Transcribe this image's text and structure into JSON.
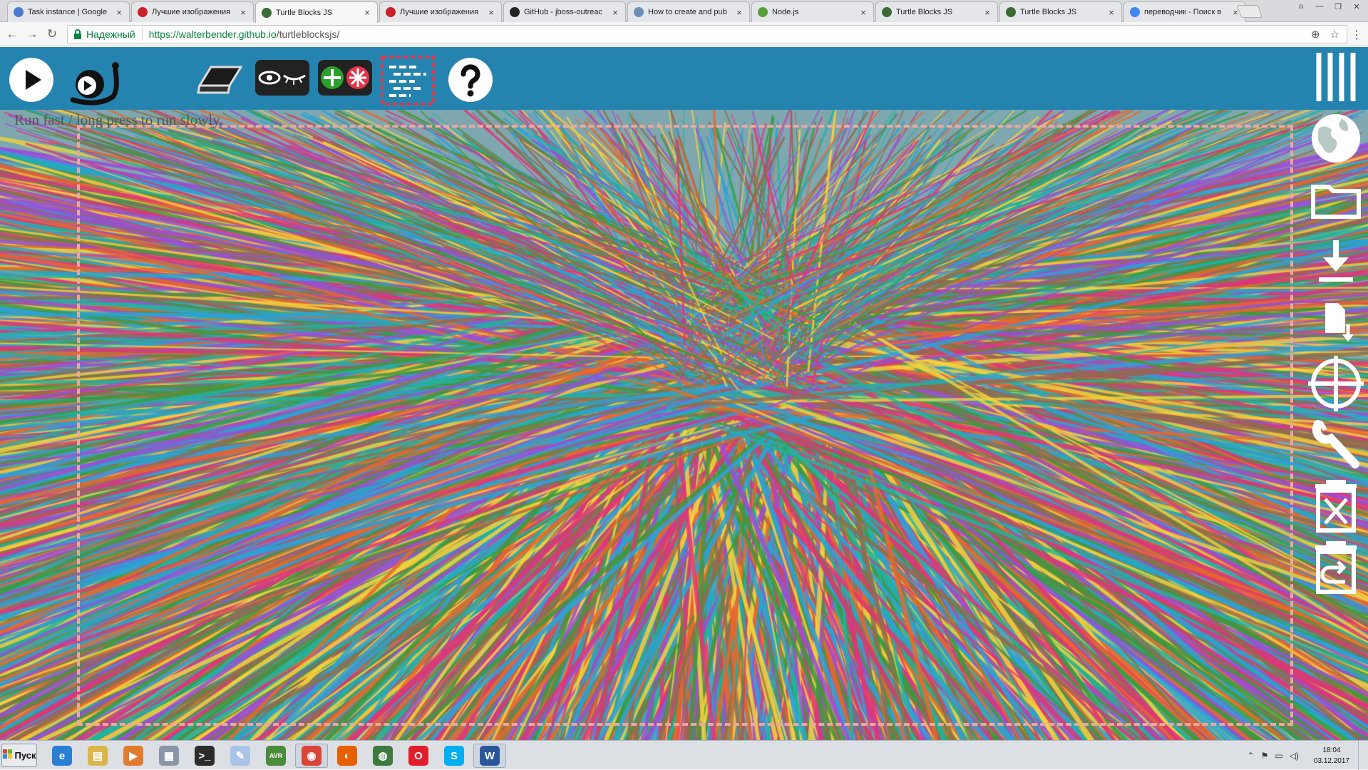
{
  "browser": {
    "tabs": [
      {
        "title": "Task instance | Google",
        "favicon": "gear-icon",
        "color": "#4a7bd0",
        "active": false
      },
      {
        "title": "Лучшие изображения",
        "favicon": "pinterest-icon",
        "color": "#cb2027",
        "active": false
      },
      {
        "title": "Turtle Blocks JS",
        "favicon": "turtle-icon",
        "color": "#3b6b34",
        "active": true
      },
      {
        "title": "Лучшие изображения",
        "favicon": "pinterest-icon",
        "color": "#cb2027",
        "active": false
      },
      {
        "title": "GitHub - jboss-outreac",
        "favicon": "github-icon",
        "color": "#222222",
        "active": false
      },
      {
        "title": "How to create and pub",
        "favicon": "eye-icon",
        "color": "#6a8fb5",
        "active": false
      },
      {
        "title": "Node.js",
        "favicon": "nodejs-icon",
        "color": "#5a9e3b",
        "active": false
      },
      {
        "title": "Turtle Blocks JS",
        "favicon": "turtle-icon",
        "color": "#3b6b34",
        "active": false
      },
      {
        "title": "Turtle Blocks JS",
        "favicon": "turtle-icon",
        "color": "#3b6b34",
        "active": false
      },
      {
        "title": "переводчик - Поиск в",
        "favicon": "google-icon",
        "color": "#4285f4",
        "active": false
      }
    ],
    "secure_label": "Надежный",
    "url_host": "https://walterbender.github.io",
    "url_path": "/turtleblocksjs/"
  },
  "app": {
    "hint": "Run fast / long press to run slowly.",
    "bar_color": "#2584af",
    "toolbar_icons": [
      "run-fast-icon",
      "run-slow-snail-icon",
      "clear-eraser-icon",
      "show-hide-blocks-icon",
      "expand-collapse-icon",
      "block-collapse-icon",
      "help-icon"
    ],
    "side_icons": [
      "menu-icon",
      "planet-icon",
      "open-folder-icon",
      "save-download-icon",
      "save-paste-icon",
      "grid-crosshair-icon",
      "settings-wrench-icon",
      "delete-trash-icon",
      "restore-trash-icon"
    ],
    "line_colors": [
      "#e0357a",
      "#2aa3d6",
      "#3d9a3d",
      "#9a4fd8",
      "#f5d23a",
      "#e8682a",
      "#1fb4a0",
      "#8d6e4e"
    ]
  },
  "taskbar": {
    "start_label": "Пуск",
    "apps": [
      {
        "name": "internet-explorer-icon",
        "color": "#2a7fd4",
        "glyph": "e"
      },
      {
        "name": "explorer-folder-icon",
        "color": "#d9b54a",
        "glyph": "▤"
      },
      {
        "name": "media-player-icon",
        "color": "#e27b2e",
        "glyph": "▶"
      },
      {
        "name": "calculator-icon",
        "color": "#8a96a8",
        "glyph": "▦"
      },
      {
        "name": "terminal-icon",
        "color": "#2b2b2b",
        "glyph": ">_"
      },
      {
        "name": "notepad-icon",
        "color": "#a9c4e6",
        "glyph": "✎"
      },
      {
        "name": "avr-studio-icon",
        "color": "#4c8a3c",
        "glyph": "AVR"
      },
      {
        "name": "chrome-icon",
        "color": "#db4437",
        "glyph": "◉"
      },
      {
        "name": "firefox-icon",
        "color": "#e66000",
        "glyph": "◐"
      },
      {
        "name": "network-globe-icon",
        "color": "#3d7a3d",
        "glyph": "◍"
      },
      {
        "name": "opera-icon",
        "color": "#e11e2c",
        "glyph": "O"
      },
      {
        "name": "skype-icon",
        "color": "#00aff0",
        "glyph": "S"
      },
      {
        "name": "word-icon",
        "color": "#2b579a",
        "glyph": "W"
      }
    ],
    "time": "18:04",
    "date": "03.12.2017"
  }
}
